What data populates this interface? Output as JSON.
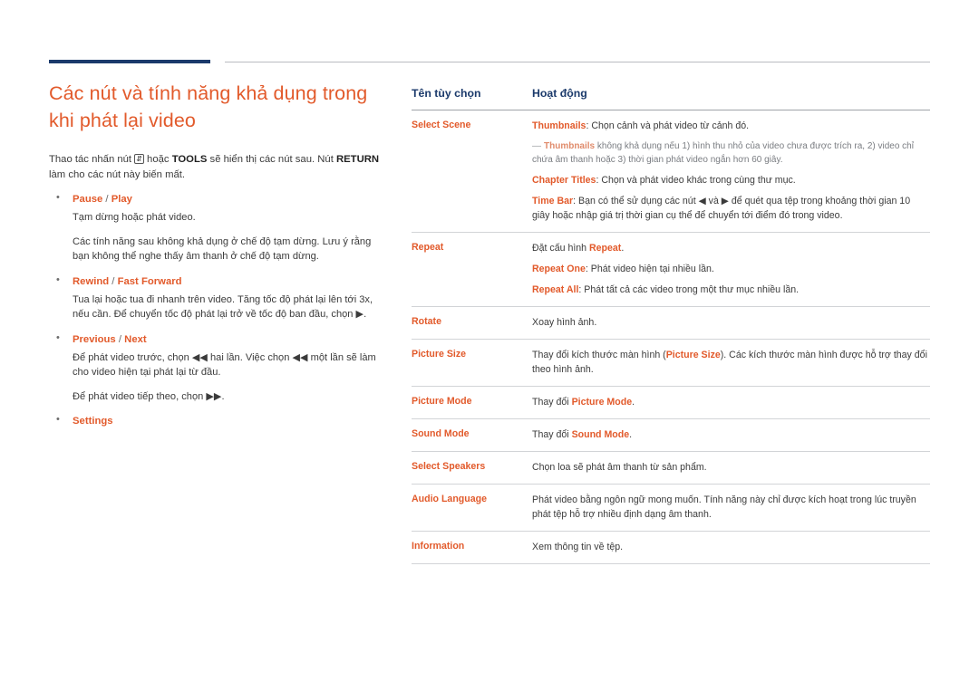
{
  "left": {
    "title": "Các nút và tính năng khả dụng trong khi phát lại video",
    "intro_pre": "Thao tác nhấn nút ",
    "intro_key1": "TOOLS",
    "intro_mid": " sẽ hiển thị các nút sau. Nút ",
    "intro_key2": "RETURN",
    "intro_post": " làm cho các nút này biến mất.",
    "intro_or": " hoặc ",
    "items": [
      {
        "head_a": "Pause",
        "head_b": "Play",
        "body": [
          "Tạm dừng hoặc phát video.",
          "Các tính năng sau không khả dụng ở chế độ tạm dừng. Lưu ý rằng bạn không thể nghe thấy âm thanh ở chế độ tạm dừng."
        ]
      },
      {
        "head_a": "Rewind",
        "head_b": "Fast Forward",
        "body": [
          "Tua lại hoặc tua đi nhanh trên video. Tăng tốc độ phát lại lên tới 3x, nếu cần. Để chuyển tốc độ phát lại trở về tốc độ ban đầu, chọn ▶."
        ]
      },
      {
        "head_a": "Previous",
        "head_b": "Next",
        "body": [
          "Để phát video trước, chọn ◀◀ hai lần. Việc chọn ◀◀ một lần sẽ làm cho video hiện tại phát lại từ đầu.",
          "Để phát video tiếp theo, chọn ▶▶."
        ]
      },
      {
        "head_a": "Settings",
        "head_b": "",
        "body": []
      }
    ]
  },
  "table": {
    "header": {
      "col1": "Tên tùy chọn",
      "col2": "Hoạt động"
    },
    "rows": [
      {
        "name": "Select Scene",
        "lines": [
          {
            "type": "main",
            "pre_kw": "Thumbnails",
            "text": ": Chọn cảnh và phát video từ cảnh đó."
          },
          {
            "type": "sub",
            "dash": "—",
            "pre_kw": "Thumbnails",
            "text": " không khả dụng nếu 1) hình thu nhỏ của video chưa được trích ra, 2) video chỉ chứa âm thanh hoặc 3) thời gian phát video ngắn hơn 60 giây."
          },
          {
            "type": "main",
            "pre_kw": "Chapter Titles",
            "text": ": Chọn và phát video khác trong cùng thư mục."
          },
          {
            "type": "main",
            "pre_kw": "Time Bar",
            "text": ": Bạn có thể sử dụng các nút ◀ và ▶ để quét qua tệp trong khoảng thời gian 10 giây hoặc nhập giá trị thời gian cụ thể để chuyển tới điểm đó trong video."
          }
        ]
      },
      {
        "name": "Repeat",
        "lines": [
          {
            "type": "main",
            "pre": "Đặt cấu hình ",
            "pre_kw": "Repeat",
            "text": "."
          },
          {
            "type": "main",
            "pre_kw": "Repeat One",
            "text": ": Phát video hiện tại nhiều lần."
          },
          {
            "type": "main",
            "pre_kw": "Repeat All",
            "text": ": Phát tất cả các video trong một thư mục nhiều lần."
          }
        ]
      },
      {
        "name": "Rotate",
        "lines": [
          {
            "type": "main",
            "text": "Xoay hình ảnh."
          }
        ]
      },
      {
        "name": "Picture Size",
        "lines": [
          {
            "type": "main",
            "pre": "Thay đổi kích thước màn hình (",
            "pre_kw": "Picture Size",
            "text": "). Các kích thước màn hình được hỗ trợ thay đổi theo hình ảnh."
          }
        ]
      },
      {
        "name": "Picture Mode",
        "lines": [
          {
            "type": "main",
            "pre": "Thay đổi ",
            "pre_kw": "Picture Mode",
            "text": "."
          }
        ]
      },
      {
        "name": "Sound Mode",
        "lines": [
          {
            "type": "main",
            "pre": "Thay đổi ",
            "pre_kw": "Sound Mode",
            "text": "."
          }
        ]
      },
      {
        "name": "Select Speakers",
        "lines": [
          {
            "type": "main",
            "text": "Chọn loa sẽ phát âm thanh từ sản phẩm."
          }
        ]
      },
      {
        "name": "Audio Language",
        "lines": [
          {
            "type": "main",
            "text": "Phát video bằng ngôn ngữ mong muốn. Tính năng này chỉ được kích hoạt trong lúc truyền phát tệp hỗ trợ nhiều định dạng âm thanh."
          }
        ]
      },
      {
        "name": "Information",
        "lines": [
          {
            "type": "main",
            "text": "Xem thông tin về tệp."
          }
        ]
      }
    ]
  },
  "colors": {
    "accent_orange": "#e25a2b",
    "accent_navy": "#1b3a6b",
    "body_text": "#3b3b3b",
    "muted": "#7a7d82"
  }
}
